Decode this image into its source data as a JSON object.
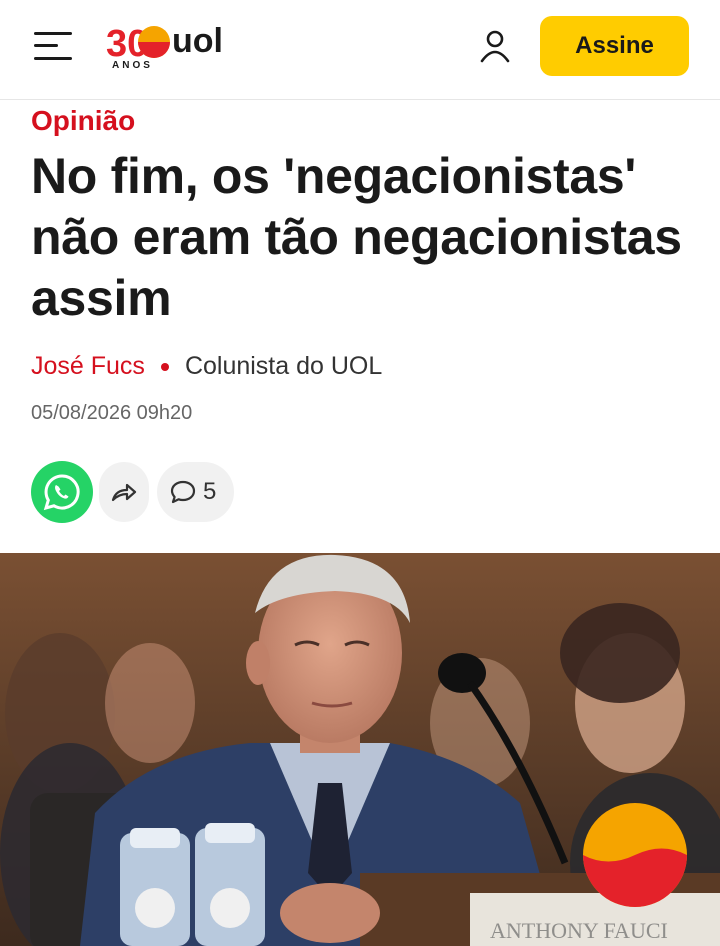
{
  "header": {
    "logo_number": "30",
    "logo_brand": "uol",
    "logo_sub": "ANOS",
    "menu_icon": "hamburger-menu-icon",
    "user_icon": "user-icon",
    "subscribe_label": "Assine",
    "accent_color": "#ffcc00"
  },
  "article": {
    "section": "Opinião",
    "title": "No fim, os 'negacionistas' não eram tão negacionistas assim",
    "author": "José Fucs",
    "author_role": "Colunista do UOL",
    "date": "05/08/2026 09h20",
    "brand_red": "#d5101e"
  },
  "share": {
    "whatsapp_icon": "whatsapp-icon",
    "share_icon": "share-arrow-icon",
    "comment_icon": "comment-bubble-icon",
    "comment_count": "5"
  },
  "photo": {
    "nameplate_text": "ANTHONY FAUCI"
  },
  "floating_button": {
    "icon": "uol-sun-badge-icon"
  }
}
